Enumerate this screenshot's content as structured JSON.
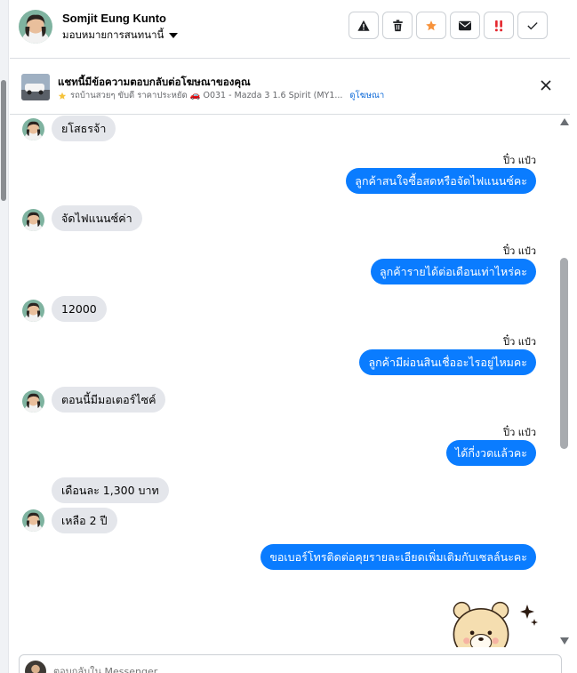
{
  "header": {
    "name": "Somjit Eung Kunto",
    "assign_label": "มอบหมายการสนทนานี้"
  },
  "ad": {
    "title": "แชทนี้มีข้อความตอบกลับต่อโฆษณาของคุณ",
    "subtitle": "รถบ้านสวยๆ ขับดี ราคาประหยัด 🚗 O031 - Mazda 3 1.6 Spirit (MY1...",
    "link": "ดูโฆษณา"
  },
  "sender_name": "ปิ๋ว แป๋ว",
  "messages": [
    {
      "dir": "in",
      "text": "ยโสธรจ้า"
    },
    {
      "dir": "out",
      "text": "ลูกค้าสนใจซื้อสดหรือจัดไฟแนนซ์คะ"
    },
    {
      "dir": "in",
      "text": "จัดไฟแนนซ์ค่า"
    },
    {
      "dir": "out",
      "text": "ลูกค้ารายได้ต่อเดือนเท่าไหร่คะ"
    },
    {
      "dir": "in",
      "text": "12000"
    },
    {
      "dir": "out",
      "text": "ลูกค้ามีผ่อนสินเชื่ออะไรอยู่ไหมคะ"
    },
    {
      "dir": "in",
      "text": "ตอนนี้มีมอเตอร์ไซค์"
    },
    {
      "dir": "out",
      "text": "ได้กี่งวดแล้วคะ"
    },
    {
      "dir": "in",
      "text": "เดือนละ 1,300 บาท"
    },
    {
      "dir": "in",
      "text": "เหลือ 2 ปี"
    },
    {
      "dir": "out",
      "text": "ขอเบอร์โทรติดต่อคุยรายละเอียดเพิ่มเติมกับเซลล์นะคะ"
    }
  ],
  "composer": {
    "placeholder": "ตอบกลับใน Messenger"
  },
  "colors": {
    "outgoing_bubble": "#0a7cff",
    "incoming_bubble": "#e4e6eb",
    "link": "#0a68d8"
  },
  "icons": {
    "toolbar": [
      "warning-icon",
      "trash-icon",
      "star-icon",
      "mail-icon",
      "urgent-icon",
      "check-icon"
    ]
  }
}
